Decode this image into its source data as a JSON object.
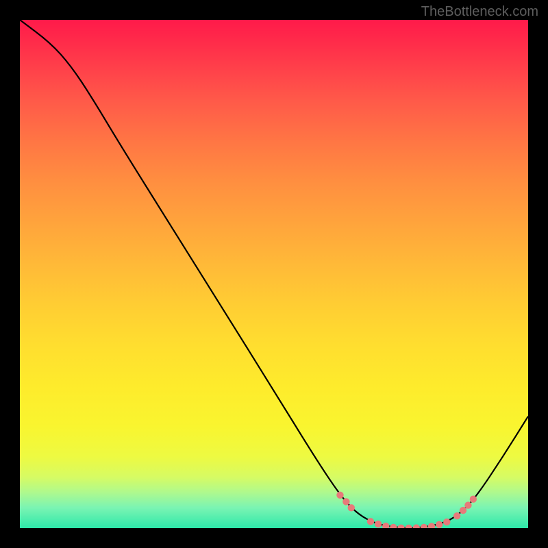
{
  "watermark": "TheBottleneck.com",
  "chart_data": {
    "type": "line",
    "title": "",
    "xlabel": "",
    "ylabel": "",
    "xlim": [
      0,
      100
    ],
    "ylim": [
      0,
      100
    ],
    "curve": [
      {
        "x": 0,
        "y": 100
      },
      {
        "x": 6,
        "y": 95.5
      },
      {
        "x": 10,
        "y": 91
      },
      {
        "x": 14,
        "y": 85
      },
      {
        "x": 20,
        "y": 75
      },
      {
        "x": 30,
        "y": 59
      },
      {
        "x": 40,
        "y": 43
      },
      {
        "x": 50,
        "y": 27
      },
      {
        "x": 58,
        "y": 14
      },
      {
        "x": 63,
        "y": 6.5
      },
      {
        "x": 66,
        "y": 3.2
      },
      {
        "x": 69,
        "y": 1.3
      },
      {
        "x": 72,
        "y": 0.4
      },
      {
        "x": 76,
        "y": 0.0
      },
      {
        "x": 80,
        "y": 0.2
      },
      {
        "x": 84,
        "y": 1.2
      },
      {
        "x": 87,
        "y": 3.2
      },
      {
        "x": 90,
        "y": 6.5
      },
      {
        "x": 95,
        "y": 14
      },
      {
        "x": 100,
        "y": 22
      }
    ],
    "markers": [
      {
        "x": 63,
        "y": 6.5
      },
      {
        "x": 64.2,
        "y": 5.2
      },
      {
        "x": 65.2,
        "y": 4.0
      },
      {
        "x": 69,
        "y": 1.3
      },
      {
        "x": 70.5,
        "y": 0.8
      },
      {
        "x": 72,
        "y": 0.4
      },
      {
        "x": 73.5,
        "y": 0.15
      },
      {
        "x": 75,
        "y": 0.02
      },
      {
        "x": 76.5,
        "y": 0.0
      },
      {
        "x": 78,
        "y": 0.05
      },
      {
        "x": 79.5,
        "y": 0.15
      },
      {
        "x": 81,
        "y": 0.35
      },
      {
        "x": 82.5,
        "y": 0.7
      },
      {
        "x": 84,
        "y": 1.2
      },
      {
        "x": 86,
        "y": 2.4
      },
      {
        "x": 87.2,
        "y": 3.5
      },
      {
        "x": 88.2,
        "y": 4.5
      },
      {
        "x": 89.2,
        "y": 5.7
      }
    ],
    "marker_color": "#e77a7a",
    "curve_color": "#000000",
    "gradient_stops": [
      {
        "pos": 0,
        "color": "#ff1a4a"
      },
      {
        "pos": 50,
        "color": "#ffcd33"
      },
      {
        "pos": 100,
        "color": "#2de8a9"
      }
    ]
  }
}
